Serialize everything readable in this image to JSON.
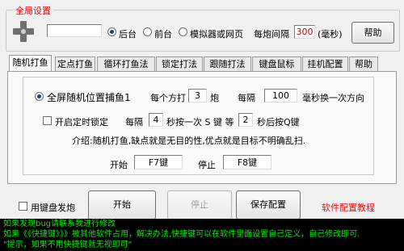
{
  "global": {
    "title": "全局设置",
    "hotkey_value": "",
    "mode_options": [
      "后台",
      "前台",
      "模拟器或网页"
    ],
    "mode_selected": 0,
    "interval_label": "每炮间隔",
    "interval_value": "300",
    "interval_unit": "(毫秒)",
    "help_label": "帮助"
  },
  "tabs": [
    "随机打鱼",
    "定点打鱼",
    "循环打鱼法",
    "锁定打法",
    "跟随打法",
    "键盘鼠标",
    "挂机配置",
    "帮助"
  ],
  "active_tab": 0,
  "panel": {
    "fullscreen_label": "全屏随机位置捕鱼1",
    "per_aim_label": "每个方打",
    "per_aim_value": "3",
    "shots_unit": "炮",
    "every_label": "每隔",
    "every_value": "100",
    "direction_label": "毫秒换一次方向",
    "timed_lock_label": "开启定时锁定",
    "lock_every_label": "每隔",
    "lock_every_value": "4",
    "lock_press_label": "秒按一次 S 键 等",
    "lock_wait_value": "2",
    "lock_after_label": "秒后按Q键",
    "intro_text": "介绍:随机打鱼,缺点就是无目的性,优点就是目标不明确乱扫.",
    "start_label": "开始",
    "start_key": "F7键",
    "stop_label": "停止",
    "stop_key": "F8键"
  },
  "bottom": {
    "keyboard_fire_label": "用键盘发炮",
    "start_button": "开始",
    "stop_button": "停止",
    "save_button": "保存配置",
    "tutorial_link": "软件配置教程"
  },
  "footer": {
    "line1": "如果发现bug请联系我进行修改",
    "line2": "如果《《快捷键》》》被其他软件占用，解决办法,快捷键可以在软件里面设置自己定义，自己修改即可.",
    "line3": "\"提示，如果不用快捷键就无视即可\""
  },
  "colors": {
    "legend_red": "#ff0000",
    "footer_bg": "#000000",
    "footer_text": "#00ee00",
    "link_red": "#ff0000"
  }
}
